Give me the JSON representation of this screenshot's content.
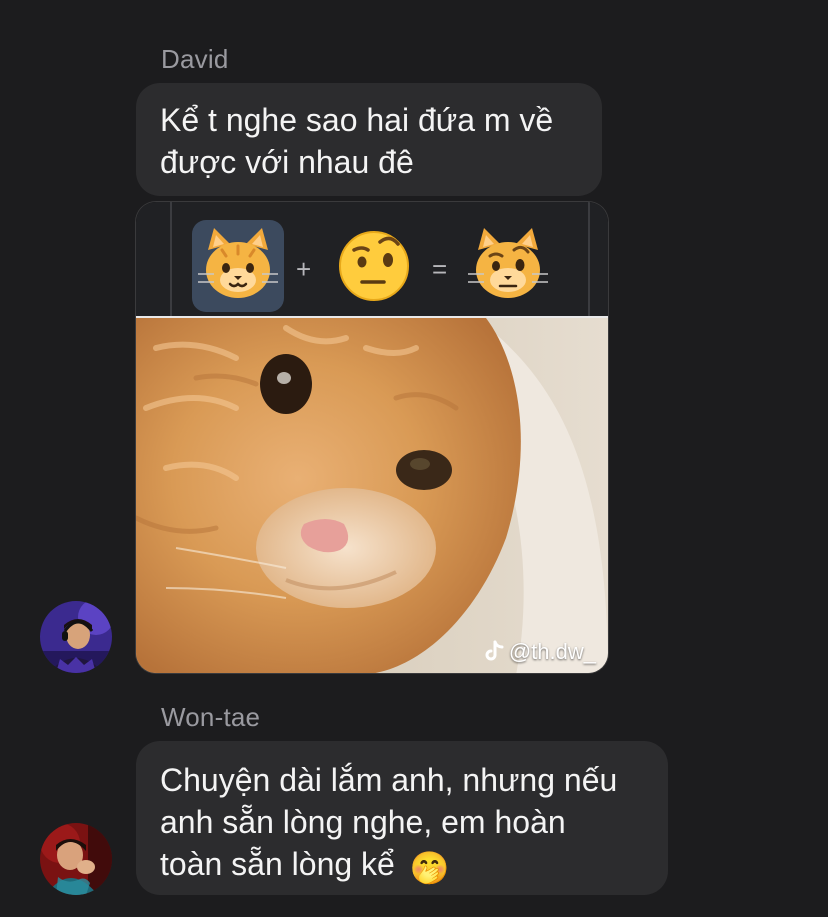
{
  "messages": [
    {
      "sender": "David",
      "text_lines": [
        "Kể t nghe sao hai đứa m về",
        "được với nhau đê"
      ],
      "attachment": {
        "emoji_equation": {
          "operand_a": "cat-face-emoji",
          "plus": "+",
          "operand_b": "face-with-raised-eyebrow-emoji",
          "equals": "=",
          "result": "cat-face-with-raised-eyebrow-emoji"
        },
        "watermark": "@th.dw_",
        "watermark_icon": "tiktok-icon"
      }
    },
    {
      "sender": "Won-tae",
      "text_lines": [
        "Chuyện dài lắm anh, nhưng nếu",
        "anh sẵn lòng nghe, em hoàn",
        "toàn sẵn lòng kể"
      ],
      "trailing_emoji": "🤭"
    }
  ],
  "colors": {
    "background": "#1c1c1e",
    "bubble": "#2c2c2e",
    "sender_name": "#9a9aa0",
    "text": "#f4f4f4"
  }
}
